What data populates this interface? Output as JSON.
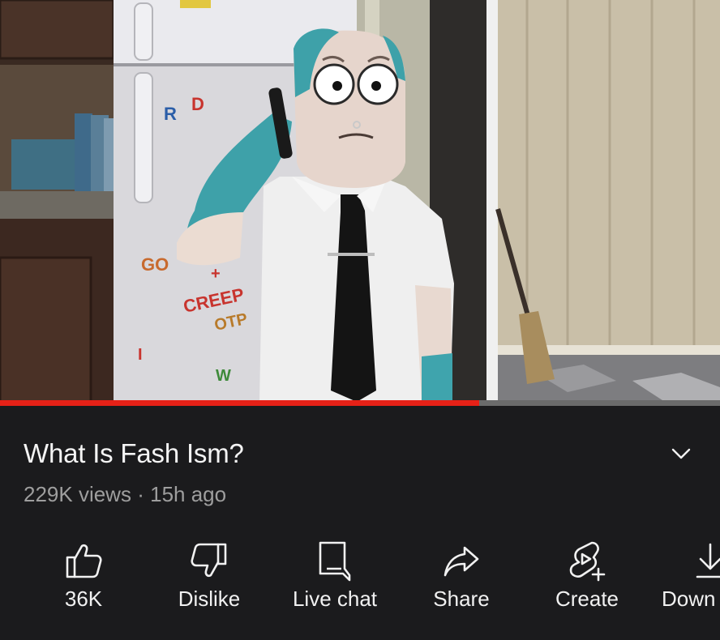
{
  "video": {
    "scene_label": "Animated video frame: cartoon man in white shirt and black tie talking on phone in front of refrigerator",
    "progress_fraction": 0.665
  },
  "magnets": {
    "r": "R",
    "d": "D",
    "go": "GO",
    "creep": "CREEP",
    "otp": "OTP",
    "i": "I",
    "w": "W",
    "plus": "+"
  },
  "info": {
    "title": "What Is Fash Ism?",
    "views": "229K views",
    "separator": "·",
    "age": "15h ago"
  },
  "actions": {
    "like_label": "36K",
    "dislike_label": "Dislike",
    "live_chat_label": "Live chat",
    "share_label": "Share",
    "create_label": "Create",
    "download_label": "Down"
  },
  "icons": {
    "expand": "chevron-down-icon",
    "like": "thumbs-up-icon",
    "dislike": "thumbs-down-icon",
    "live_chat": "chat-bubble-icon",
    "share": "share-arrow-icon",
    "create": "create-plus-icon",
    "download": "download-icon"
  },
  "colors": {
    "progress_played": "#e62117",
    "progress_track": "#6b6b6b",
    "panel_bg": "#1b1b1d",
    "title_text": "#f4f4f4",
    "meta_text": "#9e9e9e"
  }
}
